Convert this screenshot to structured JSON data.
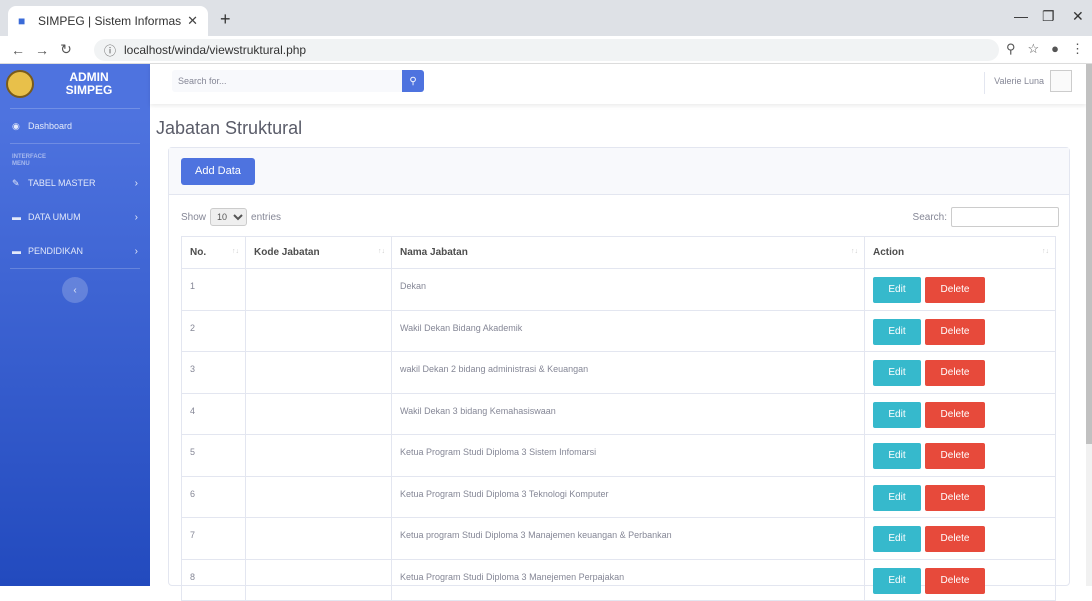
{
  "browser": {
    "tab_title": "SIMPEG | Sistem Informasi Kepeg",
    "url": "localhost/winda/viewstruktural.php"
  },
  "sidebar": {
    "brand_line1": "ADMIN",
    "brand_line2": "SIMPEG",
    "dashboard": "Dashboard",
    "heading_line1": "INTERFACE",
    "heading_line2": "MENU",
    "items": [
      {
        "label": "TABEL MASTER"
      },
      {
        "label": "DATA UMUM"
      },
      {
        "label": "PENDIDIKAN"
      }
    ]
  },
  "topbar": {
    "search_placeholder": "Search for...",
    "user_name": "Valerie Luna"
  },
  "main": {
    "page_title": "Jabatan Struktural",
    "add_button": "Add Data",
    "show_label": "Show",
    "entries_value": "10",
    "entries_label": "entries",
    "search_label": "Search:",
    "columns": [
      "No.",
      "Kode Jabatan",
      "Nama Jabatan",
      "Action"
    ],
    "edit_label": "Edit",
    "delete_label": "Delete",
    "rows": [
      {
        "no": "1",
        "kode": "",
        "nama": "Dekan"
      },
      {
        "no": "2",
        "kode": "",
        "nama": "Wakil Dekan Bidang Akademik"
      },
      {
        "no": "3",
        "kode": "",
        "nama": "wakil Dekan 2 bidang administrasi & Keuangan"
      },
      {
        "no": "4",
        "kode": "",
        "nama": "Wakil Dekan 3 bidang Kemahasiswaan"
      },
      {
        "no": "5",
        "kode": "",
        "nama": "Ketua Program Studi Diploma 3 Sistem Infomarsi"
      },
      {
        "no": "6",
        "kode": "",
        "nama": "Ketua Program Studi Diploma 3 Teknologi Komputer"
      },
      {
        "no": "7",
        "kode": "",
        "nama": "Ketua program Studi Diploma 3 Manajemen keuangan & Perbankan"
      },
      {
        "no": "8",
        "kode": "",
        "nama": "Ketua Program Studi Diploma 3 Manejemen Perpajakan"
      }
    ]
  }
}
